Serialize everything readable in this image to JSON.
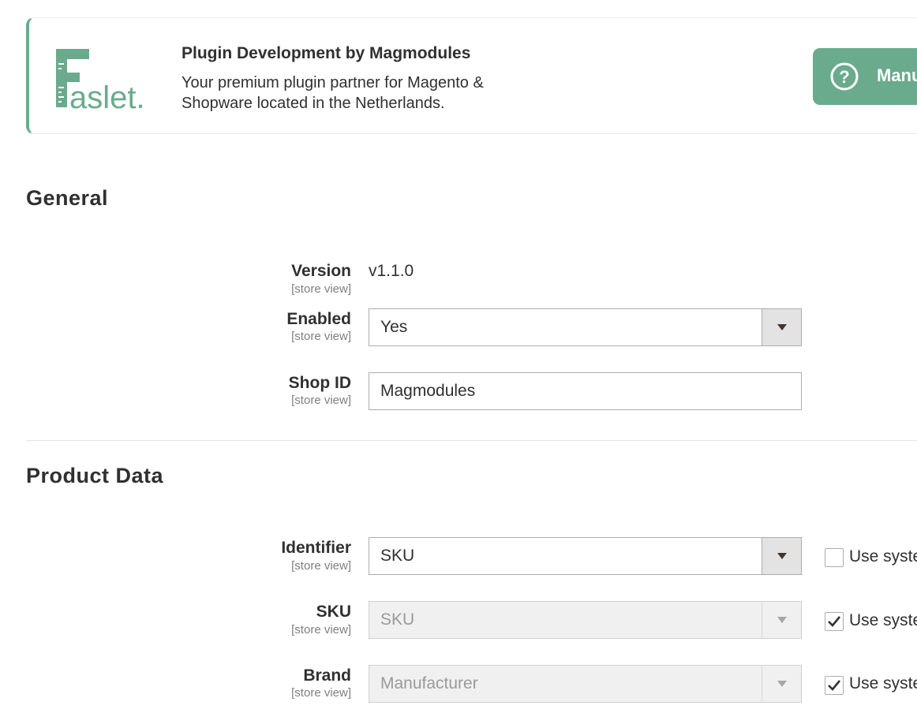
{
  "banner": {
    "logo_text": "Faslet.",
    "title": "Plugin Development by Magmodules",
    "description": "Your premium plugin partner for Magento & Shopware located in the Netherlands.",
    "manual_button": "Manu"
  },
  "general": {
    "title": "General",
    "version": {
      "label": "Version",
      "scope": "[store view]",
      "value": "v1.1.0"
    },
    "enabled": {
      "label": "Enabled",
      "scope": "[store view]",
      "value": "Yes"
    },
    "shop_id": {
      "label": "Shop ID",
      "scope": "[store view]",
      "value": "Magmodules"
    }
  },
  "product_data": {
    "title": "Product Data",
    "identifier": {
      "label": "Identifier",
      "scope": "[store view]",
      "value": "SKU",
      "use_system": "Use syste",
      "checked": false
    },
    "sku": {
      "label": "SKU",
      "scope": "[store view]",
      "value": "SKU",
      "use_system": "Use syste",
      "checked": true
    },
    "brand": {
      "label": "Brand",
      "scope": "[store view]",
      "value": "Manufacturer",
      "use_system": "Use syste",
      "checked": true
    }
  },
  "colors": {
    "accent": "#6aab8d",
    "text": "#303030",
    "muted": "#808080"
  }
}
